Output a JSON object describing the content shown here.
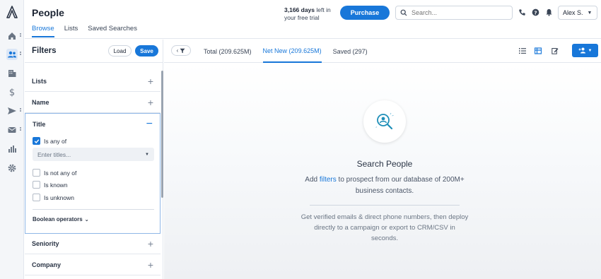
{
  "rail": {
    "items": [
      {
        "name": "home-icon"
      },
      {
        "name": "people-icon",
        "active": true
      },
      {
        "name": "building-icon"
      },
      {
        "name": "dollar-icon"
      },
      {
        "name": "send-icon"
      },
      {
        "name": "mail-icon"
      },
      {
        "name": "analytics-icon"
      },
      {
        "name": "settings-icon"
      }
    ]
  },
  "header": {
    "title": "People",
    "tabs": [
      {
        "label": "Browse",
        "active": true
      },
      {
        "label": "Lists"
      },
      {
        "label": "Saved Searches"
      }
    ],
    "trial_days": "3,166 days",
    "trial_rest_1": " left in",
    "trial_rest_2": "your free trial",
    "purchase_label": "Purchase",
    "search_placeholder": "Search...",
    "user_name": "Alex S."
  },
  "filters": {
    "title": "Filters",
    "load_label": "Load",
    "save_label": "Save",
    "rows": [
      {
        "label": "Lists",
        "sign": "+"
      },
      {
        "label": "Name",
        "sign": "+"
      }
    ],
    "title_filter": {
      "label": "Title",
      "sign": "−",
      "is_any_of": "Is any of",
      "select_placeholder": "Enter titles...",
      "is_not_any_of": "Is not any of",
      "is_known": "Is known",
      "is_unknown": "Is unknown",
      "boolean_operators": "Boolean operators"
    },
    "rows_after": [
      {
        "label": "Seniority",
        "sign": "+"
      },
      {
        "label": "Company",
        "sign": "+"
      }
    ]
  },
  "toolbar": {
    "tabs": [
      {
        "label": "Total (209.625M)"
      },
      {
        "label": "Net New (209.625M)",
        "active": true
      },
      {
        "label": "Saved (297)"
      }
    ]
  },
  "empty_state": {
    "title": "Search People",
    "desc_prefix": "Add ",
    "desc_link": "filters",
    "desc_suffix": " to prospect from our database of 200M+ business contacts.",
    "note": "Get verified emails & direct phone numbers, then deploy directly to a campaign or export to CRM/CSV in seconds."
  },
  "colors": {
    "accent": "#1877d9",
    "rail_bg": "#f4f6f9",
    "border": "#e3e7ee"
  }
}
